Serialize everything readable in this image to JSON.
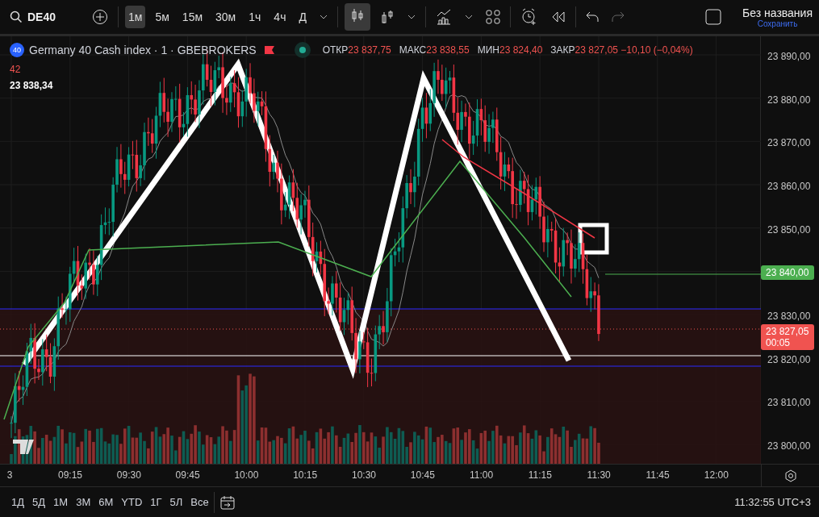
{
  "toolbar": {
    "symbol": "DE40",
    "intervals": [
      {
        "label": "1м",
        "selected": true
      },
      {
        "label": "5м",
        "selected": false
      },
      {
        "label": "15м",
        "selected": false
      },
      {
        "label": "30м",
        "selected": false
      },
      {
        "label": "1ч",
        "selected": false
      },
      {
        "label": "4ч",
        "selected": false
      },
      {
        "label": "Д",
        "selected": false
      }
    ],
    "layout_title": "Без названия",
    "save_label": "Сохранить"
  },
  "legend": {
    "badge": "40",
    "title": "Germany 40 Cash index · 1 · GBEBROKERS",
    "ohlc": [
      {
        "label": "ОТКР",
        "value": "23 837,75"
      },
      {
        "label": "МАКС",
        "value": "23 838,55"
      },
      {
        "label": "МИН",
        "value": "23 824,40"
      },
      {
        "label": "ЗАКР",
        "value": "23 827,05 −10,10 (−0,04%)"
      }
    ],
    "indicator_value": "42",
    "crosshair_value": "23 838,34"
  },
  "price_axis": [
    {
      "kind": "tick",
      "text": "23 890,00"
    },
    {
      "kind": "tick",
      "text": "23 880,00"
    },
    {
      "kind": "tick",
      "text": "23 870,00"
    },
    {
      "kind": "tick",
      "text": "23 860,00"
    },
    {
      "kind": "tick",
      "text": "23 850,00"
    },
    {
      "kind": "tick_tag",
      "text": "23 840,00",
      "color": "#4caf50"
    },
    {
      "kind": "tick",
      "text": "23 830,00"
    },
    {
      "kind": "last_price",
      "text": "23 827,05",
      "sub": "00:05",
      "color": "#f05350"
    },
    {
      "kind": "tick",
      "text": "23 820,00"
    },
    {
      "kind": "tick",
      "text": "23 810,00"
    },
    {
      "kind": "tick",
      "text": "23 800,00"
    }
  ],
  "time_axis": [
    "3",
    "09:15",
    "09:30",
    "09:45",
    "10:00",
    "10:15",
    "10:30",
    "10:45",
    "11:00",
    "11:15",
    "11:30",
    "11:45",
    "12:00"
  ],
  "ranges": [
    "1Д",
    "5Д",
    "1М",
    "3М",
    "6М",
    "YTD",
    "1Г",
    "5Л",
    "Все"
  ],
  "clock": "11:32:55 UTC+3"
}
